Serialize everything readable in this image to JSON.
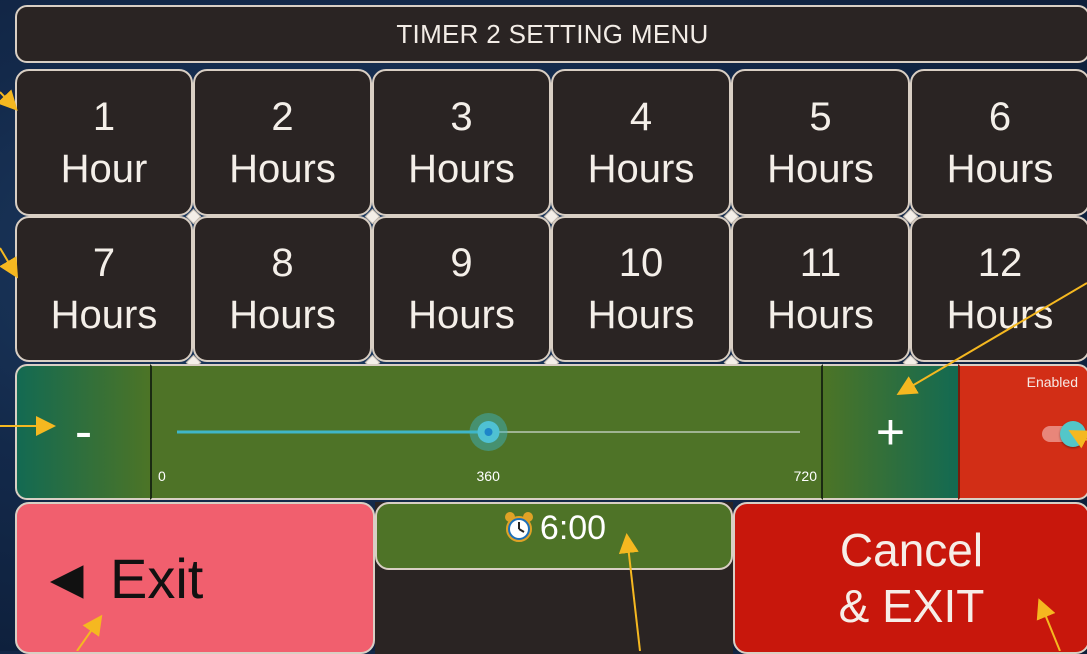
{
  "title": "TIMER 2 SETTING MENU",
  "hour_buttons": [
    {
      "num": "1",
      "unit": "Hour"
    },
    {
      "num": "2",
      "unit": "Hours"
    },
    {
      "num": "3",
      "unit": "Hours"
    },
    {
      "num": "4",
      "unit": "Hours"
    },
    {
      "num": "5",
      "unit": "Hours"
    },
    {
      "num": "6",
      "unit": "Hours"
    },
    {
      "num": "7",
      "unit": "Hours"
    },
    {
      "num": "8",
      "unit": "Hours"
    },
    {
      "num": "9",
      "unit": "Hours"
    },
    {
      "num": "10",
      "unit": "Hours"
    },
    {
      "num": "11",
      "unit": "Hours"
    },
    {
      "num": "12",
      "unit": "Hours"
    }
  ],
  "slider": {
    "min_label": "0",
    "value_label": "360",
    "max_label": "720",
    "min": 0,
    "max": 720,
    "value": 360
  },
  "minus_label": "-",
  "plus_label": "+",
  "toggle": {
    "label": "Enabled",
    "on": true
  },
  "exit_label": "◄ Exit",
  "time_display": "6:00",
  "cancel_label_line1": "Cancel",
  "cancel_label_line2": "& EXIT",
  "colors": {
    "accent_cyan": "#3fb6c9",
    "slider_green": "#4e7327",
    "exit_pink": "#f15f6e",
    "cancel_red": "#c8170c",
    "annotation_arrow": "#f5b820"
  },
  "icons": {
    "alarm": "alarm-clock-icon"
  }
}
